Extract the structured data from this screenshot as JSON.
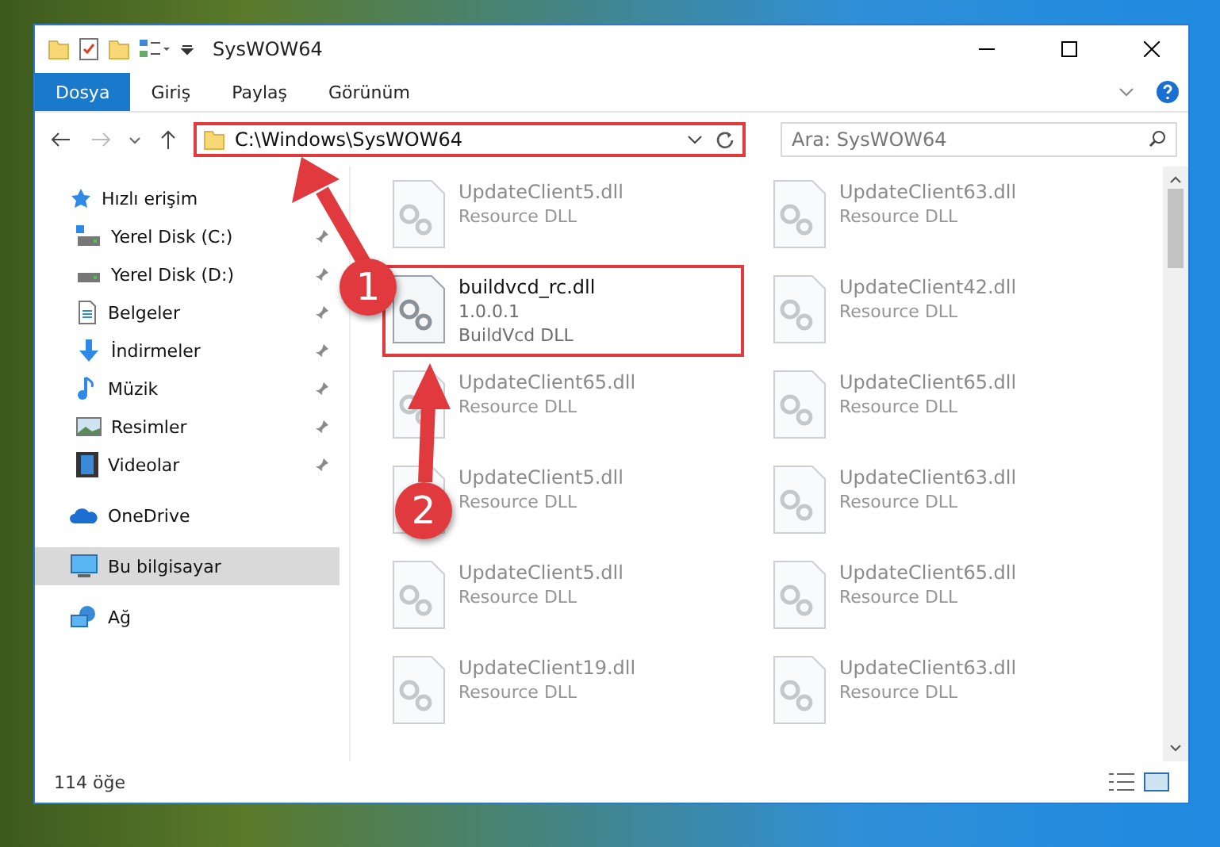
{
  "window": {
    "title": "SysWOW64"
  },
  "ribbon_tabs": [
    {
      "label": "Dosya",
      "kind": "file"
    },
    {
      "label": "Giriş",
      "kind": "tab"
    },
    {
      "label": "Paylaş",
      "kind": "tab"
    },
    {
      "label": "Görünüm",
      "kind": "tab"
    }
  ],
  "address_bar": {
    "path": "C:\\Windows\\SysWOW64",
    "highlighted": true
  },
  "search": {
    "placeholder": "Ara: SysWOW64"
  },
  "sidebar": {
    "items": [
      {
        "label": "Hızlı erişim",
        "kind": "section",
        "selected": false
      },
      {
        "label": "Yerel Disk (C:)",
        "kind": "pinned",
        "selected": false
      },
      {
        "label": "Yerel Disk (D:)",
        "kind": "pinned",
        "selected": false
      },
      {
        "label": "Belgeler",
        "kind": "pinned",
        "selected": false
      },
      {
        "label": "İndirmeler",
        "kind": "pinned",
        "selected": false
      },
      {
        "label": "Müzik",
        "kind": "pinned",
        "selected": false
      },
      {
        "label": "Resimler",
        "kind": "pinned",
        "selected": false
      },
      {
        "label": "Videolar",
        "kind": "pinned",
        "selected": false
      },
      {
        "label": "OneDrive",
        "kind": "section",
        "selected": false
      },
      {
        "label": "Bu bilgisayar",
        "kind": "section",
        "selected": true
      },
      {
        "label": "Ağ",
        "kind": "section",
        "selected": false
      }
    ]
  },
  "files": [
    {
      "name": "UpdateClient5.dll",
      "lines": [
        "Resource DLL"
      ],
      "blurred": true,
      "highlighted": false
    },
    {
      "name": "UpdateClient63.dll",
      "lines": [
        "Resource DLL"
      ],
      "blurred": true,
      "highlighted": false
    },
    {
      "name": "buildvcd_rc.dll",
      "lines": [
        "1.0.0.1",
        "BuildVcd DLL"
      ],
      "blurred": false,
      "highlighted": true
    },
    {
      "name": "UpdateClient42.dll",
      "lines": [
        "Resource DLL"
      ],
      "blurred": true,
      "highlighted": false
    },
    {
      "name": "UpdateClient65.dll",
      "lines": [
        "Resource DLL"
      ],
      "blurred": true,
      "highlighted": false
    },
    {
      "name": "UpdateClient65.dll",
      "lines": [
        "Resource DLL"
      ],
      "blurred": true,
      "highlighted": false
    },
    {
      "name": "UpdateClient5.dll",
      "lines": [
        "Resource DLL"
      ],
      "blurred": true,
      "highlighted": false
    },
    {
      "name": "UpdateClient63.dll",
      "lines": [
        "Resource DLL"
      ],
      "blurred": true,
      "highlighted": false
    },
    {
      "name": "UpdateClient5.dll",
      "lines": [
        "Resource DLL"
      ],
      "blurred": true,
      "highlighted": false
    },
    {
      "name": "UpdateClient65.dll",
      "lines": [
        "Resource DLL"
      ],
      "blurred": true,
      "highlighted": false
    },
    {
      "name": "UpdateClient19.dll",
      "lines": [
        "Resource DLL"
      ],
      "blurred": true,
      "highlighted": false
    },
    {
      "name": "UpdateClient63.dll",
      "lines": [
        "Resource DLL"
      ],
      "blurred": true,
      "highlighted": false
    }
  ],
  "callouts": [
    {
      "label": "1"
    },
    {
      "label": "2"
    }
  ],
  "status_bar": {
    "count": "114 öğe"
  }
}
